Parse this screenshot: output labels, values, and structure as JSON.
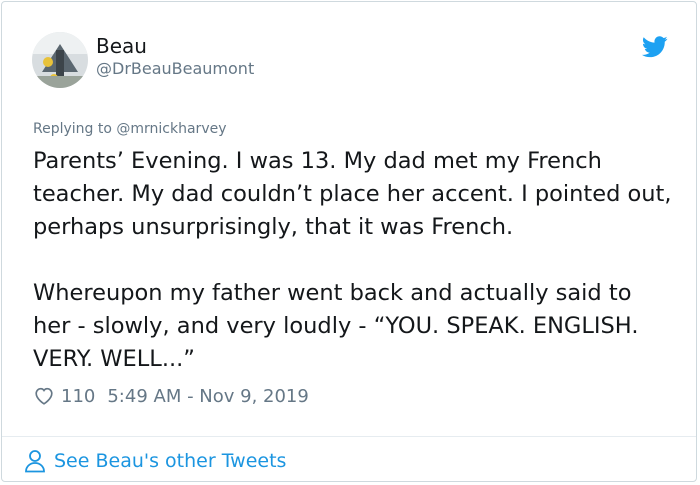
{
  "author": {
    "display_name": "Beau",
    "handle": "@DrBeauBeaumont"
  },
  "reply": {
    "prefix": "Replying to ",
    "mention": "@mrnickharvey"
  },
  "tweet_text": "Parents’ Evening. I was 13. My dad met my French teacher. My dad couldn’t place her accent. I pointed out, perhaps unsurprisingly, that it was French.\n\nWhereupon my father went back and actually said to her - slowly, and very loudly - “YOU. SPEAK. ENGLISH. VERY. WELL...”",
  "likes": "110",
  "timestamp": "5:49 AM - Nov 9, 2019",
  "footer": {
    "link_text": "See Beau's other Tweets"
  },
  "colors": {
    "brand": "#1da1f2",
    "link": "#1b95e0",
    "muted": "#657786"
  },
  "icons": [
    "twitter-bird-icon",
    "heart-icon",
    "person-icon"
  ]
}
